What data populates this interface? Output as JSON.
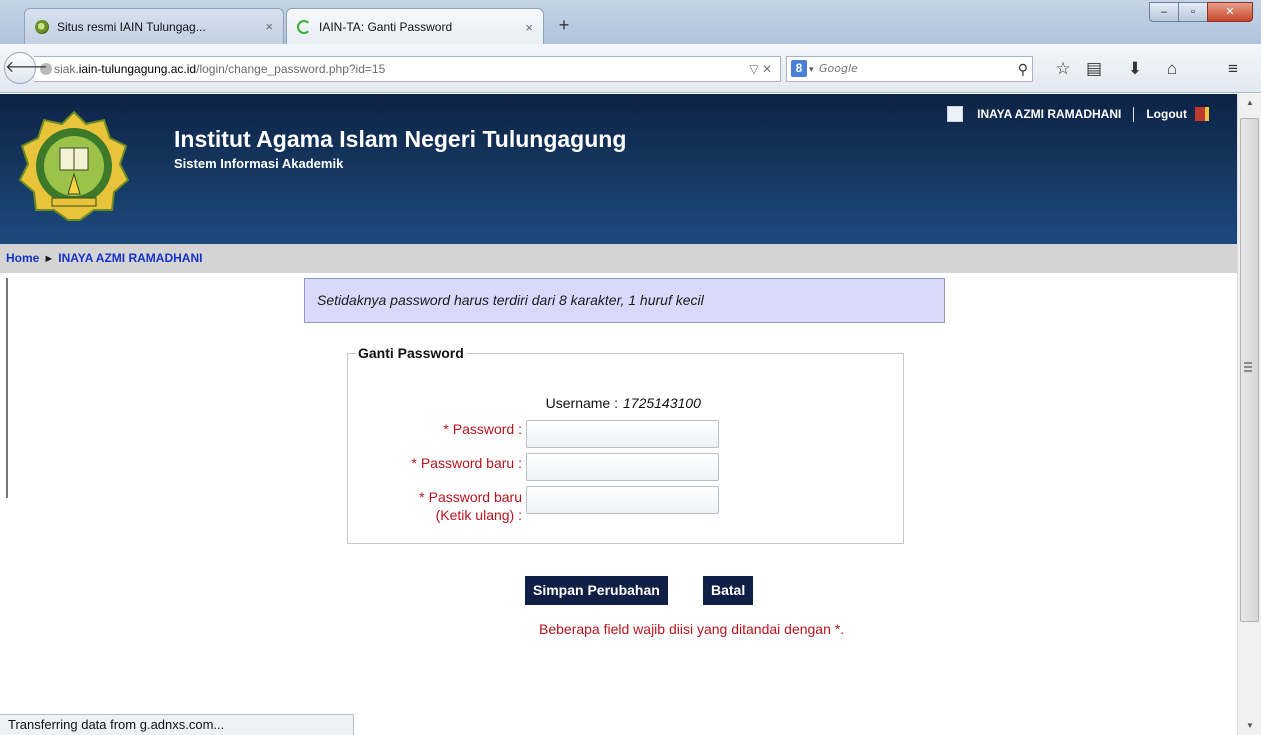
{
  "browser": {
    "tabs": [
      {
        "title": "Situs resmi IAIN Tulungag...",
        "active": false
      },
      {
        "title": "IAIN-TA: Ganti Password",
        "active": true
      }
    ],
    "tab_close": "×",
    "new_tab": "+",
    "url": {
      "prefix": "siak.",
      "host": "iain-tulungagung.ac.id",
      "path": "/login/change_password.php?id=15"
    },
    "url_controls": "▽ ✕",
    "search": {
      "engine_label": "8",
      "placeholder": "Google"
    },
    "status": "Transferring data from g.adnxs.com..."
  },
  "header": {
    "title": "Institut Agama Islam Negeri Tulungagung",
    "subtitle": "Sistem Informasi Akademik",
    "user_name": "INAYA AZMI RAMADHANI",
    "logout": "Logout"
  },
  "breadcrumb": {
    "home": "Home",
    "separator": "►",
    "current": "INAYA AZMI RAMADHANI"
  },
  "notice": "Setidaknya password harus terdiri dari 8 karakter, 1 huruf kecil",
  "form": {
    "legend": "Ganti Password",
    "username_label": "Username :",
    "username_value": "1725143100",
    "required_mark": "*",
    "password_label": "Password :",
    "new_password_label": "Password baru :",
    "retype_label_line1": "Password baru",
    "retype_label_line2": "(Ketik ulang) :",
    "password_value": "",
    "new_password_value": "",
    "retype_value": ""
  },
  "buttons": {
    "save": "Simpan Perubahan",
    "cancel": "Batal"
  },
  "required_note": "Beberapa field wajib diisi yang ditandai dengan",
  "required_note_mark": "*.",
  "colors": {
    "header_dark": "#0d2244",
    "header_light": "#1c4a7e",
    "breadcrumb_link": "#1433cc",
    "required": "#b8141d",
    "notice_bg": "#d9d9fb",
    "button_bg": "#0f1f45"
  }
}
